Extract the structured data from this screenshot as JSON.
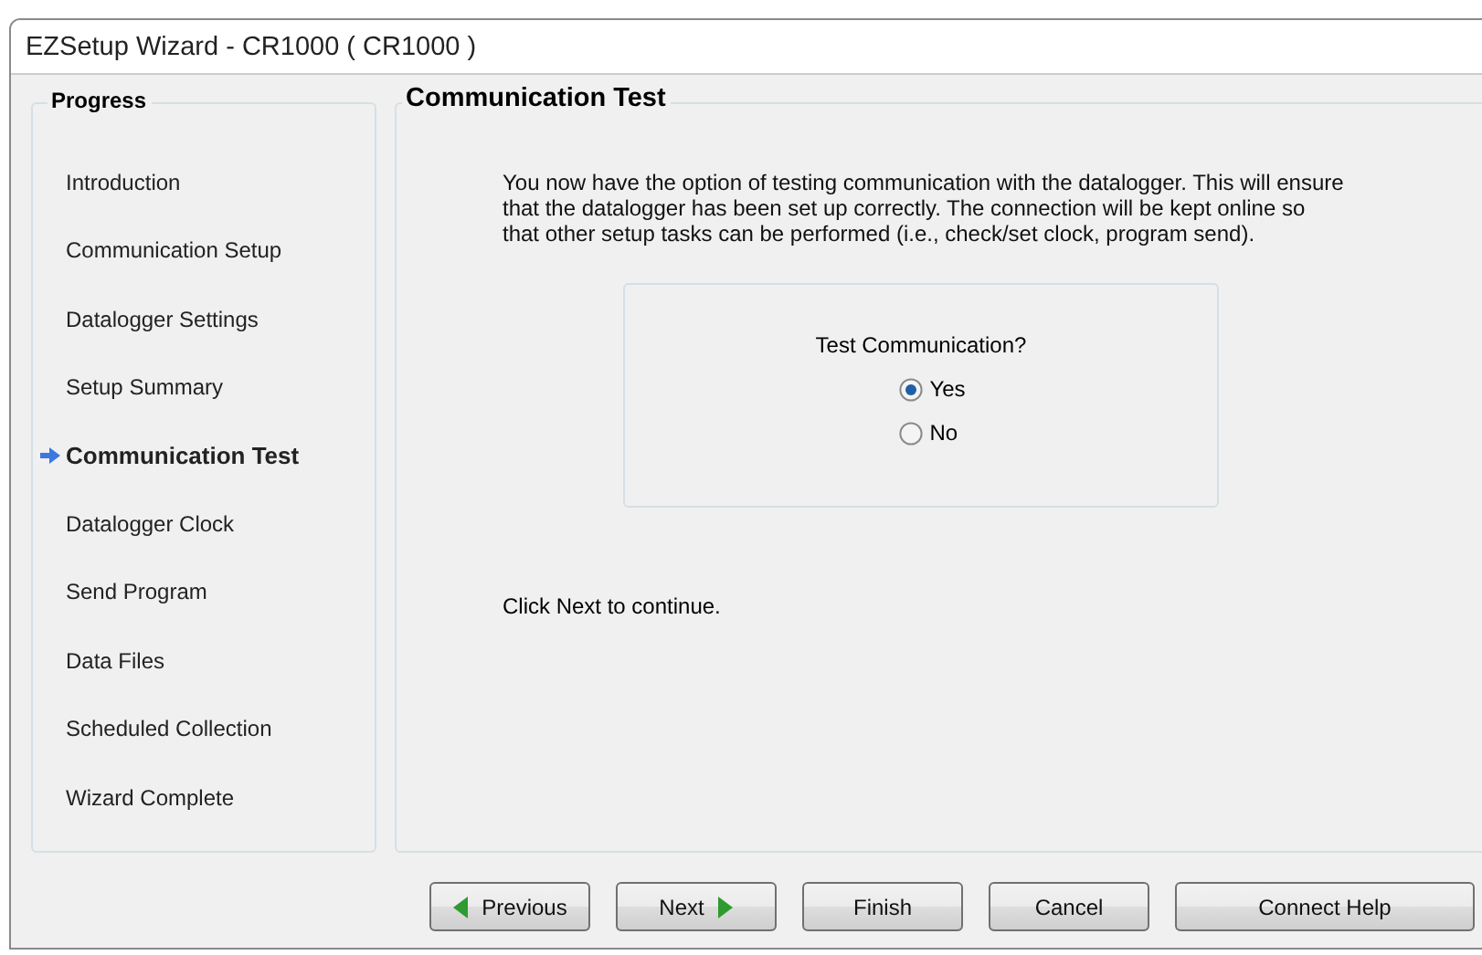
{
  "window": {
    "title": "EZSetup Wizard - CR1000 ( CR1000 )"
  },
  "sidebar": {
    "title": "Progress",
    "items": [
      {
        "label": "Introduction",
        "selected": false
      },
      {
        "label": "Communication Setup",
        "selected": false
      },
      {
        "label": "Datalogger Settings",
        "selected": false
      },
      {
        "label": "Setup Summary",
        "selected": false
      },
      {
        "label": "Communication Test",
        "selected": true
      },
      {
        "label": "Datalogger Clock",
        "selected": false
      },
      {
        "label": "Send Program",
        "selected": false
      },
      {
        "label": "Data Files",
        "selected": false
      },
      {
        "label": "Scheduled Collection",
        "selected": false
      },
      {
        "label": "Wizard Complete",
        "selected": false
      }
    ]
  },
  "page": {
    "title": "Communication Test",
    "description": "You now have the option of testing communication with the datalogger.  This will ensure that the datalogger has been set up correctly.  The connection will be kept online so that other setup tasks can be performed (i.e., check/set clock, program send).",
    "question": "Test Communication?",
    "options": [
      {
        "label": "Yes",
        "selected": true
      },
      {
        "label": "No",
        "selected": false
      }
    ],
    "footer": "Click Next to continue."
  },
  "buttons": [
    {
      "label": "Previous",
      "kind": "back"
    },
    {
      "label": "Next",
      "kind": "forward"
    },
    {
      "label": "Finish",
      "kind": "plain"
    },
    {
      "label": "Cancel",
      "kind": "plain"
    },
    {
      "label": "Connect Help",
      "kind": "wide"
    }
  ]
}
